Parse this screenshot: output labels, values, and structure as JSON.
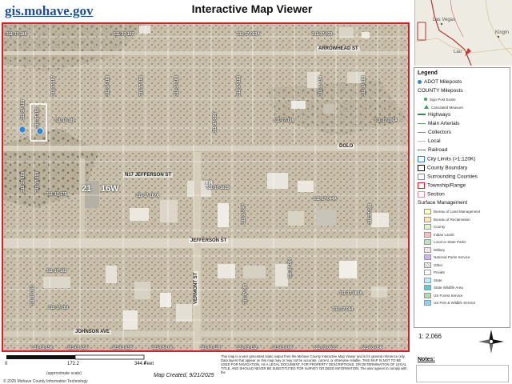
{
  "header": {
    "site": "gis.mohave.gov",
    "title": "Interactive Map Viewer"
  },
  "inset": {
    "labels": [
      "Las Vegas",
      "Lau",
      "Kingm"
    ]
  },
  "map": {
    "streets": {
      "top": "ARROWHEAD ST",
      "upper": "DOLO",
      "middle": "N17 JEFFERSON ST",
      "jefferson": "JEFFERSON ST",
      "vermont": "VERMONT ST",
      "johnson": "JOHNSON AVE"
    },
    "township": "21",
    "range": "16W",
    "section": "18",
    "parcels": {
      "top_row": [
        "311-17-188",
        "311-17-187",
        "311-17-023A",
        "311-17-033"
      ],
      "upper_row": [
        "311-17-187",
        "311-17-189",
        "311-17-188",
        "311-17-189",
        "311-17-193",
        "311-17-194",
        "311-17-193"
      ],
      "left_col": [
        "311-17-193",
        "311-17-192",
        "311-17-193",
        "311-17-193"
      ],
      "block_row": [
        "311-17-189",
        "311-17-206",
        "311-17-198",
        "311-17-206A"
      ],
      "mid_left": [
        "311-17-175",
        "311-17-187A",
        "311-17-181B"
      ],
      "mid_block": [
        "311-17-044A",
        "311-17-047",
        "311-17-048"
      ],
      "lower_left": [
        "311-17-192",
        "311-17-193",
        "311-17-203"
      ],
      "lower_block": [
        "311-17-094",
        "311-17-084",
        "311-17-086A",
        "311-17-095"
      ],
      "bottom_row": [
        "321-03-158",
        "321-03-159",
        "321-03-155",
        "321-03-166",
        "321-03-128",
        "321-03-132",
        "321-03-166",
        "321-03-091C",
        "321-03-056"
      ]
    }
  },
  "legend": {
    "title": "Legend",
    "items": [
      {
        "label": "ADOT Mileposts",
        "sym": "dot-blue"
      },
      {
        "label": "COUNTY Mileposts",
        "sym": "none"
      },
      {
        "label": "Sign Post Exists",
        "sym": "dot-green",
        "sub": true
      },
      {
        "label": "Calculated Measure",
        "sym": "tri-green",
        "sub": true
      },
      {
        "label": "Highways",
        "sym": "line-green"
      },
      {
        "label": "Main Arterials",
        "sym": "line-green-thin"
      },
      {
        "label": "Collectors",
        "sym": "line-gray"
      },
      {
        "label": "Local",
        "sym": "line-gray-thin"
      },
      {
        "label": "Railroad",
        "sym": "line-red-dash"
      },
      {
        "label": "City Limits (>1:120K)",
        "sym": "box-blue"
      },
      {
        "label": "County Boundary",
        "sym": "box-black"
      },
      {
        "label": "Surrounding Counties",
        "sym": "box-gray"
      },
      {
        "label": "Township/Range",
        "sym": "box-red"
      },
      {
        "label": "Section",
        "sym": "box-pink"
      },
      {
        "label": "Surface Management",
        "sym": "none"
      },
      {
        "label": "Bureau of Land Management",
        "sym": "fill-ffffbe",
        "sub": true
      },
      {
        "label": "Bureau of Reclamation",
        "sym": "fill-ffe8aa",
        "sub": true
      },
      {
        "label": "County",
        "sym": "fill-d7f5c6",
        "sub": true
      },
      {
        "label": "Indian Lands",
        "sym": "fill-ffbebe",
        "sub": true
      },
      {
        "label": "Local or State Parks",
        "sym": "fill-b8e6b8",
        "sub": true
      },
      {
        "label": "Military",
        "sym": "hatch-e6a0c8",
        "sub": true
      },
      {
        "label": "National Parks Service",
        "sym": "fill-c8b4ff",
        "sub": true
      },
      {
        "label": "Other",
        "sym": "hatch-999999",
        "sub": true
      },
      {
        "label": "Private",
        "sym": "fill-ffffff",
        "sub": true
      },
      {
        "label": "State",
        "sym": "fill-b4f0ff",
        "sub": true
      },
      {
        "label": "State Wildlife Area",
        "sym": "fill-4fd1d1",
        "sub": true
      },
      {
        "label": "US Forest Service",
        "sym": "fill-a8e0a8",
        "sub": true
      },
      {
        "label": "US Fish & Wildlife Service",
        "sym": "fill-7fd6ff",
        "sub": true
      }
    ]
  },
  "scale_text": "1: 2,066",
  "notes_label": "Notes:",
  "scalebar": {
    "ticks": [
      "0",
      "172.2",
      "344.4"
    ],
    "unit": "Feet",
    "approx": "(approximate scale)"
  },
  "map_created": "Map Created, 9/21/2025",
  "copyright": "© 2025 Mohave County Information Technology",
  "disclaimer": "This map is a user generated static output from the Mohave County Interactive Map Viewer and is for general reference only. Data layers that appear on this map may or may not be accurate, current, or otherwise reliable. THIS MAP IS NOT TO BE USED FOR NAVIGATION, AS A LEGAL DOCUMENT, FOR PROPERTY DESCRIPTIONS, OR DETERMINATION OF LEGAL TITLE, AND SHOULD NEVER BE SUBSTITUTED FOR SURVEY OR DEED INFORMATION. The user agrees to comply with the",
  "colors": {
    "site_link": "#1f4e99",
    "frame": "#d81f26",
    "milepost": "#2f86d6"
  }
}
